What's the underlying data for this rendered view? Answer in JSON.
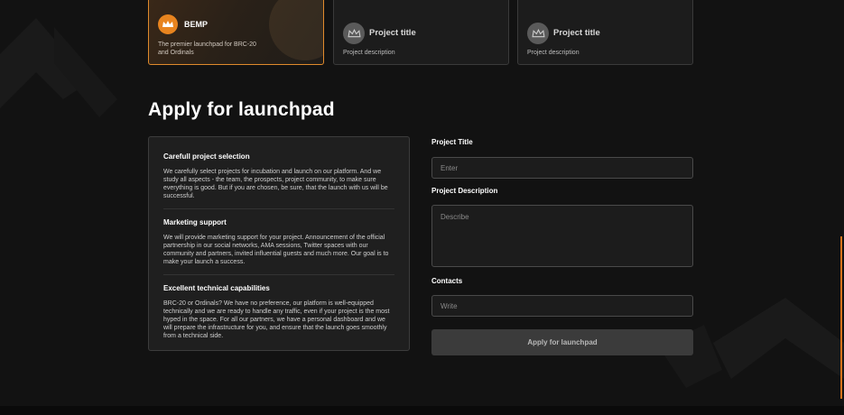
{
  "cards": {
    "featured": {
      "name": "BEMP",
      "description": "The premier launchpad for BRC-20 and Ordinals"
    },
    "placeholders": [
      {
        "title": "Project title",
        "description": "Project description"
      },
      {
        "title": "Project title",
        "description": "Project description"
      }
    ]
  },
  "page": {
    "heading": "Apply for launchpad"
  },
  "info": {
    "sections": [
      {
        "title": "Carefull project selection",
        "text": "We carefully select projects for incubation and launch on our platform. And we study all aspects - the team, the prospects, project community, to make sure everything is good. But if you are chosen, be sure, that the launch with us will be successful."
      },
      {
        "title": "Marketing support",
        "text": "We will provide marketing support for your project. Announcement of the official partnership in our social networks, AMA sessions, Twitter spaces with our community and partners, invited influential guests and much more. Our goal is to make your launch a success."
      },
      {
        "title": "Excellent technical capabilities",
        "text": "BRC-20 or Ordinals? We have no preference, our platform is well-equipped technically and we are ready to handle any traffic, even if your project is the most hyped in the space. For all our partners, we have a personal dashboard and we will prepare the infrastructure for you, and ensure that the launch goes smoothly from a technical side."
      }
    ]
  },
  "form": {
    "title_label": "Project Title",
    "title_placeholder": "Enter",
    "description_label": "Project Description",
    "description_placeholder": "Describe",
    "contacts_label": "Contacts",
    "contacts_placeholder": "Write",
    "submit_label": "Apply for launchpad"
  },
  "colors": {
    "accent": "#e8841f",
    "background": "#121212",
    "panel": "#1f1f1f"
  }
}
